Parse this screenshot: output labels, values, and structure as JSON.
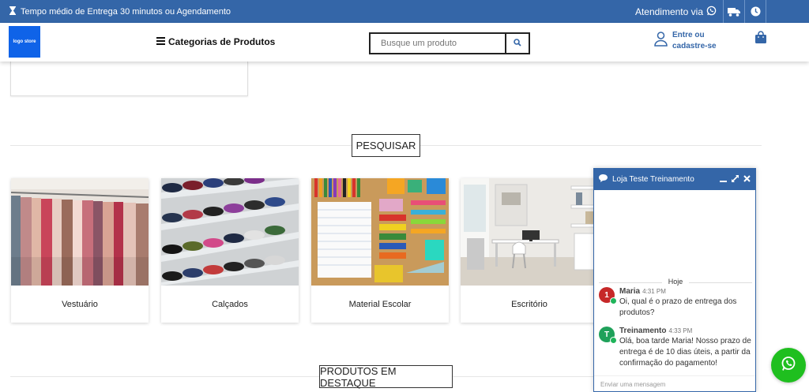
{
  "topbar": {
    "delivery_text": "Tempo médio de Entrega 30 minutos ou Agendamento",
    "attendance_text": "Atendimento via"
  },
  "header": {
    "logo_text": "logo store",
    "categories_label": "Categorias de Produtos",
    "search_placeholder": "Busque um produto",
    "account_line1": "Entre ou",
    "account_line2": "cadastre-se"
  },
  "sections": {
    "search_title": "PESQUISAR",
    "featured_title": "PRODUTOS EM DESTAQUE"
  },
  "categories": [
    {
      "label": "Vestuário"
    },
    {
      "label": "Calçados"
    },
    {
      "label": "Material Escolar"
    },
    {
      "label": "Escritório"
    }
  ],
  "chat": {
    "title": "Loja Teste Treinamento",
    "day_label": "Hoje",
    "messages": [
      {
        "initial": "1",
        "author": "Maria",
        "time": "4:31 PM",
        "text": "Oi, qual é o prazo de entrega dos produtos?"
      },
      {
        "initial": "T",
        "author": "Treinamento",
        "time": "4:33 PM",
        "text": "Olá, boa tarde Maria! Nosso prazo de entrega é de 10 dias úteis, a partir da confirmação do pagamento!"
      }
    ],
    "input_placeholder": "Enviar uma mensagem"
  },
  "colors": {
    "brand_blue": "#3466a8",
    "whatsapp_green": "#1fbf1f",
    "avatar_maria": "#c62828",
    "avatar_trainer": "#1fa15a"
  },
  "icons": [
    "hourglass-icon",
    "whatsapp-icon",
    "truck-icon",
    "clock-icon",
    "menu-icon",
    "search-icon",
    "user-icon",
    "bag-icon",
    "chat-bubble-icon",
    "minimize-icon",
    "expand-icon",
    "close-icon"
  ]
}
